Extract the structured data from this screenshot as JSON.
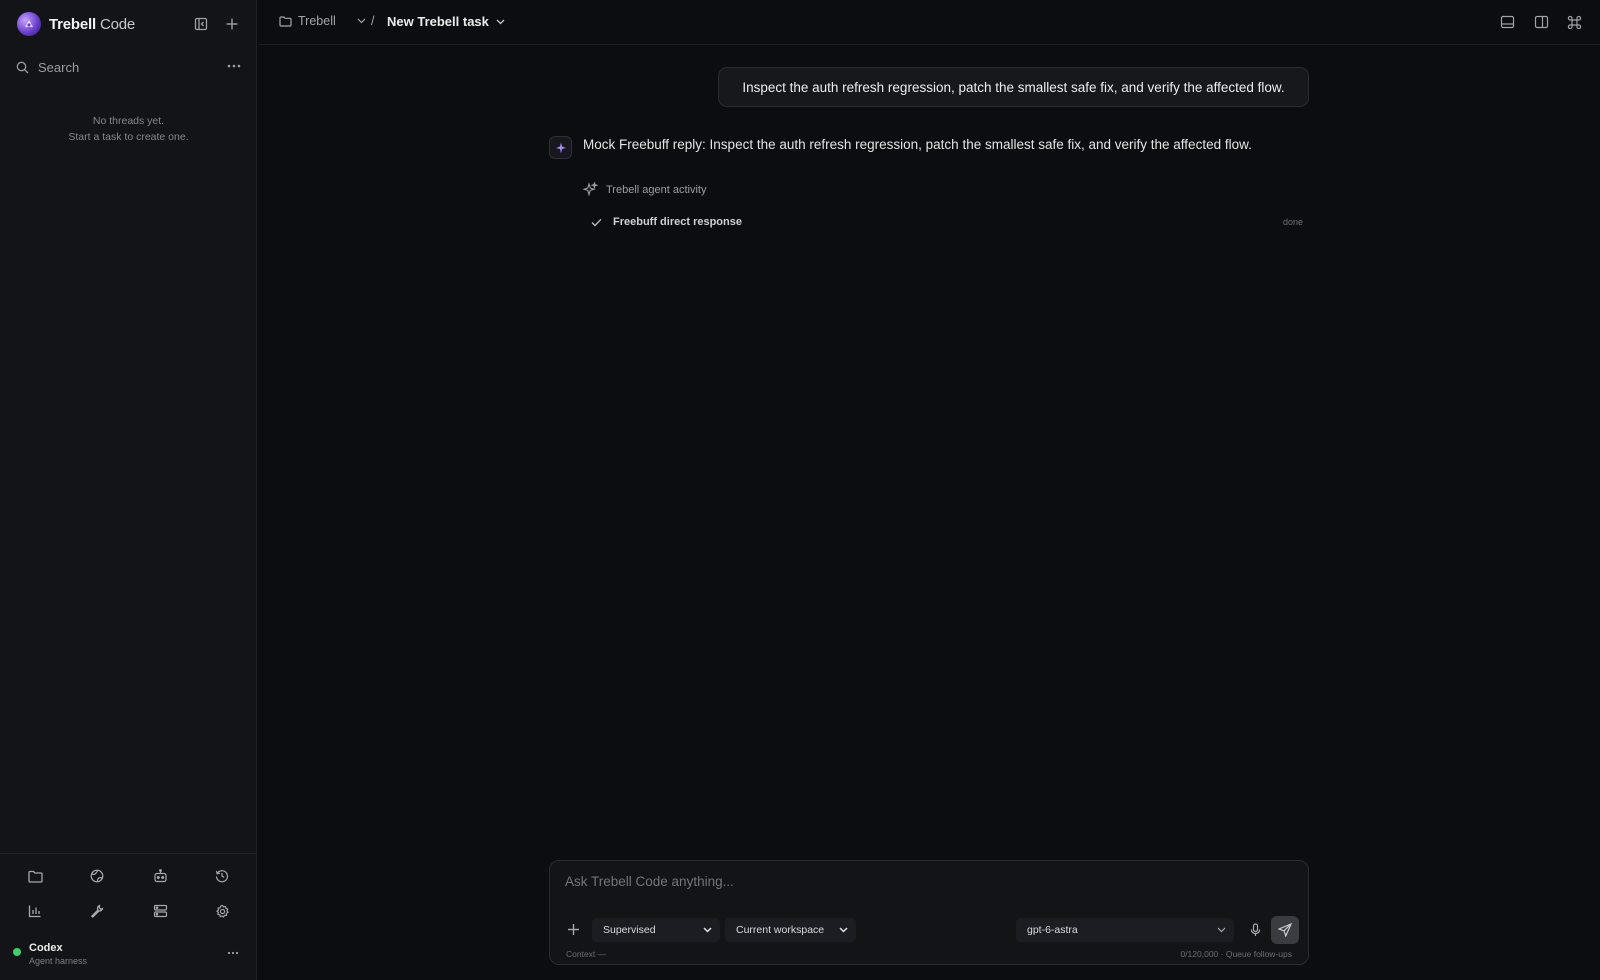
{
  "sidebar": {
    "brand_name": "Trebell",
    "brand_suffix": "Code",
    "search_label": "Search",
    "empty_line1": "No threads yet.",
    "empty_line2": "Start a task to create one.",
    "tools": [
      "folder-icon",
      "globe-icon",
      "bot-icon",
      "history-icon",
      "chart-icon",
      "wrench-icon",
      "server-icon",
      "gear-icon"
    ],
    "account": {
      "name": "Codex",
      "subtitle": "Agent harness",
      "status_color": "#3ecf6a"
    }
  },
  "topbar": {
    "project": "Trebell",
    "separator": "/",
    "task_title": "New Trebell task"
  },
  "chat": {
    "user_message": "Inspect the auth refresh regression, patch the smallest safe fix, and verify the affected flow.",
    "bot_reply": "Mock Freebuff reply: Inspect the auth refresh regression, patch the smallest safe fix, and verify the affected flow.",
    "activity": {
      "title": "Trebell agent activity",
      "items": [
        {
          "label": "Freebuff direct response",
          "status": "done"
        }
      ]
    }
  },
  "composer": {
    "placeholder": "Ask Trebell Code anything...",
    "mode": "Supervised",
    "workspace": "Current workspace",
    "model": "gpt-6-astra",
    "context_label": "Context —",
    "usage_label": "0/120,000 · Queue follow-ups"
  },
  "colors": {
    "background": "#0c0d10",
    "sidebar": "#131417",
    "accent": "#8b5cf6",
    "success": "#3ecf6a"
  }
}
